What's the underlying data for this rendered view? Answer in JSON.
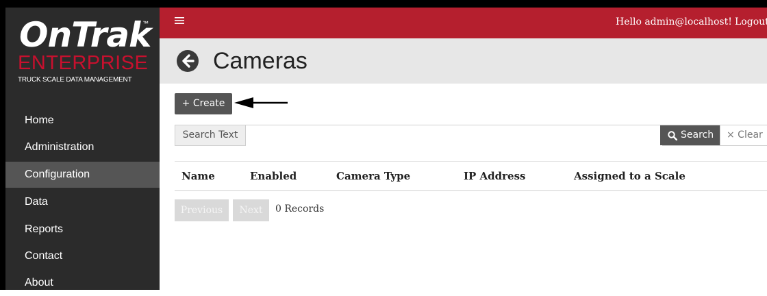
{
  "sidebar": {
    "logo": {
      "main": "OnTrak",
      "tm": "™",
      "sub": "ENTERPRISE",
      "tagline": "TRUCK SCALE DATA MANAGEMENT"
    },
    "items": [
      {
        "label": "Home"
      },
      {
        "label": "Administration"
      },
      {
        "label": "Configuration",
        "active": true
      },
      {
        "label": "Data"
      },
      {
        "label": "Reports"
      },
      {
        "label": "Contact"
      },
      {
        "label": "About"
      }
    ]
  },
  "header": {
    "menu_icon": "menu-icon",
    "greeting": "Hello admin@localhost!",
    "logout": "Logout"
  },
  "page": {
    "title": "Cameras",
    "back_icon": "arrow-left-circle-icon"
  },
  "toolbar": {
    "create_label": "+ Create"
  },
  "search": {
    "label": "Search Text",
    "value": "",
    "button": "Search",
    "clear": "× Clear"
  },
  "table": {
    "columns": [
      "Name",
      "Enabled",
      "Camera Type",
      "IP Address",
      "Assigned to a Scale"
    ]
  },
  "pager": {
    "previous": "Previous",
    "next": "Next",
    "records": "0 Records"
  },
  "colors": {
    "brand_red": "#b51f2e",
    "sidebar_bg": "#2b2b2b",
    "active_item": "#555555",
    "button_dark": "#555555"
  }
}
